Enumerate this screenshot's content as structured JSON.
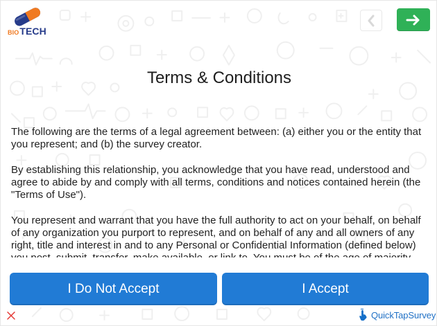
{
  "brand": {
    "logo_prefix": "BIO",
    "logo_name": "TECH",
    "footer": "QuickTapSurvey"
  },
  "page": {
    "title": "Terms & Conditions",
    "terms": [
      "The following are the terms of a legal agreement between: (a) either you or the entity that you represent; and (b) the survey creator.",
      "By establishing this relationship, you acknowledge that you have read, understood and agree to abide by and comply with all terms, conditions and notices contained herein (the \"Terms of Use\").",
      "You represent and warrant that you have the full authority to act on your behalf, on behalf of any organization you purport to represent, and on behalf of any and all owners of any right, title and interest in and to any Personal or Confidential Information (defined below) you post, submit, transfer, make available, or link to. You must be of the age of majority and are"
    ]
  },
  "actions": {
    "decline": "I Do Not Accept",
    "accept": "I Accept"
  },
  "icons": {
    "back": "chevron-left-icon",
    "next": "arrow-right-icon",
    "close": "close-icon",
    "footer": "tap-hand-icon"
  },
  "colors": {
    "primary": "#217bd5",
    "success": "#2fb157",
    "close": "#e53935",
    "footer": "#1f70c5"
  }
}
